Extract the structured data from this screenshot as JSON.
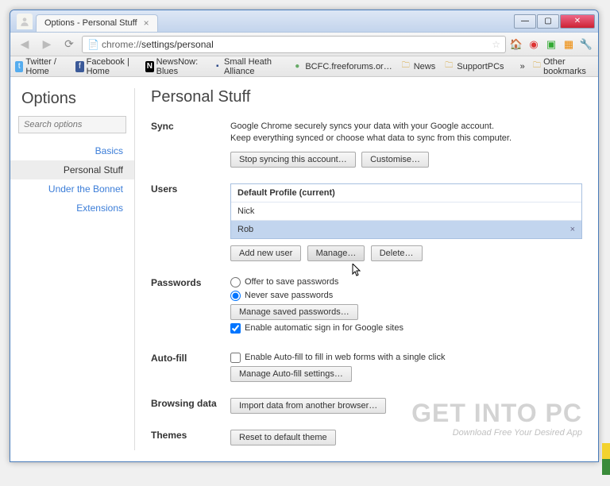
{
  "window": {
    "tab_title": "Options - Personal Stuff",
    "min_label": "—",
    "max_label": "▢",
    "close_label": "✕"
  },
  "url": {
    "scheme": "chrome://",
    "path": "settings/personal"
  },
  "bookmarks": {
    "items": [
      {
        "label": "Twitter / Home",
        "icon": "t",
        "color": "#55acee"
      },
      {
        "label": "Facebook | Home",
        "icon": "f",
        "color": "#3b5998"
      },
      {
        "label": "NewsNow: Blues",
        "icon": "N",
        "color": "#000"
      },
      {
        "label": "Small Heath Alliance",
        "icon": "■",
        "color": "#2e4a8a"
      },
      {
        "label": "BCFC.freeforums.or…",
        "icon": "●",
        "color": "#6a6"
      },
      {
        "label": "News",
        "icon": "📁",
        "color": "#d4a53a"
      },
      {
        "label": "SupportPCs",
        "icon": "📁",
        "color": "#d4a53a"
      }
    ],
    "other": "Other bookmarks"
  },
  "sidebar": {
    "title": "Options",
    "search_placeholder": "Search options",
    "items": [
      "Basics",
      "Personal Stuff",
      "Under the Bonnet",
      "Extensions"
    ],
    "active_index": 1
  },
  "page": {
    "title": "Personal Stuff",
    "sync": {
      "label": "Sync",
      "desc1": "Google Chrome securely syncs your data with your Google account.",
      "desc2": "Keep everything synced or choose what data to sync from this computer.",
      "stop_btn": "Stop syncing this account…",
      "custom_btn": "Customise…"
    },
    "users": {
      "label": "Users",
      "list": [
        {
          "name": "Default Profile (current)",
          "bold": true
        },
        {
          "name": "Nick",
          "bold": false
        },
        {
          "name": "Rob",
          "selected": true
        }
      ],
      "add_btn": "Add new user",
      "manage_btn": "Manage…",
      "delete_btn": "Delete…"
    },
    "passwords": {
      "label": "Passwords",
      "offer": "Offer to save passwords",
      "never": "Never save passwords",
      "manage_btn": "Manage saved passwords…",
      "enable_auto": "Enable automatic sign in for Google sites"
    },
    "autofill": {
      "label": "Auto-fill",
      "enable": "Enable Auto-fill to fill in web forms with a single click",
      "manage_btn": "Manage Auto-fill settings…"
    },
    "browsing": {
      "label": "Browsing data",
      "import_btn": "Import data from another browser…"
    },
    "themes": {
      "label": "Themes",
      "reset_btn": "Reset to default theme"
    }
  },
  "watermark": {
    "big": "GET INTO PC",
    "small": "Download Free Your Desired App"
  }
}
